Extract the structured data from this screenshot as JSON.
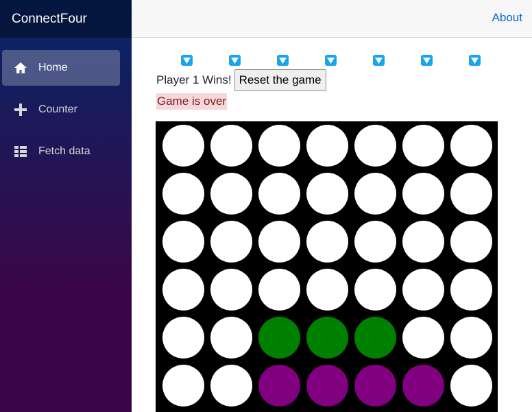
{
  "app": {
    "brand": "ConnectFour"
  },
  "nav": {
    "items": [
      {
        "label": "Home",
        "icon": "home-icon",
        "active": true
      },
      {
        "label": "Counter",
        "icon": "plus-icon",
        "active": false
      },
      {
        "label": "Fetch data",
        "icon": "list-icon",
        "active": false
      }
    ]
  },
  "topbar": {
    "about": "About"
  },
  "game": {
    "status": "Player 1 Wins!",
    "reset_label": "Reset the game",
    "message": "Game is over",
    "columns": 7,
    "rows": 6,
    "colors": {
      "empty": "#ffffff",
      "p1": "#008000",
      "p2": "#800080",
      "board": "#000000"
    },
    "board": [
      [
        0,
        0,
        0,
        0,
        0,
        0,
        0
      ],
      [
        0,
        0,
        0,
        0,
        0,
        0,
        0
      ],
      [
        0,
        0,
        0,
        0,
        0,
        0,
        0
      ],
      [
        0,
        0,
        0,
        0,
        0,
        0,
        0
      ],
      [
        0,
        0,
        1,
        1,
        1,
        0,
        0
      ],
      [
        0,
        0,
        2,
        2,
        2,
        2,
        0
      ]
    ]
  }
}
